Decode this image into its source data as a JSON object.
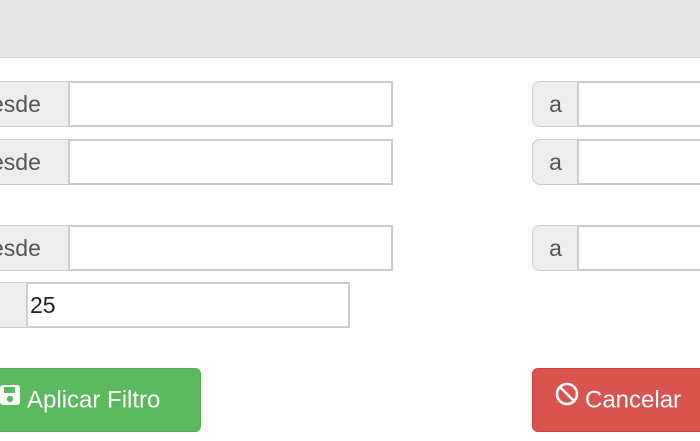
{
  "filters": {
    "rows": [
      {
        "from_label": "esde",
        "from_value": "",
        "to_label": "a",
        "to_value": ""
      },
      {
        "from_label": "esde",
        "from_value": "",
        "to_label": "a",
        "to_value": ""
      },
      {
        "from_label": "esde",
        "from_value": "",
        "to_label": "a",
        "to_value": ""
      }
    ],
    "limit_value": "25"
  },
  "buttons": {
    "apply_label": "Aplicar Filtro",
    "apply_icon": "save-icon",
    "cancel_label": "Cancelar",
    "cancel_icon": "ban-icon"
  },
  "colors": {
    "apply": "#5cb85c",
    "cancel": "#d9534f",
    "header": "#e8e8e8"
  }
}
